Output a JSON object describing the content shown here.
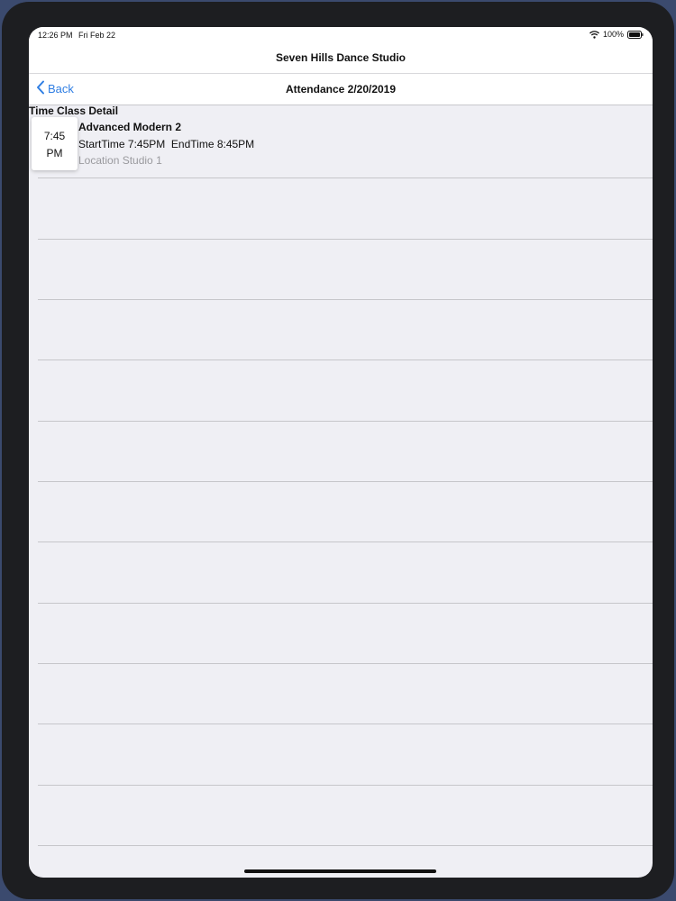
{
  "status_bar": {
    "time": "12:26 PM",
    "date": "Fri Feb 22",
    "battery": "100%"
  },
  "app": {
    "title": "Seven Hills Dance Studio"
  },
  "nav": {
    "back_label": "Back",
    "title": "Attendance 2/20/2019"
  },
  "columns": {
    "time": "Time",
    "class_detail": "Class Detail"
  },
  "classes": [
    {
      "time_hour": "7:45",
      "time_period": "PM",
      "name": "Advanced Modern 2",
      "times": "StartTime 7:45PM  EndTime 8:45PM",
      "location": "Location Studio 1"
    }
  ],
  "colors": {
    "accent": "#2f7ee3",
    "background": "#efeff4"
  }
}
